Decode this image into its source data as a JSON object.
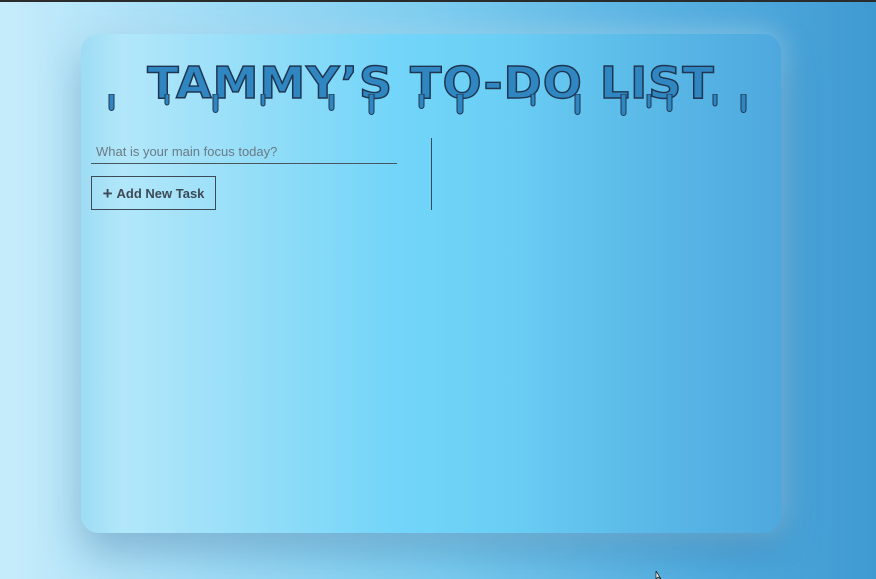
{
  "app": {
    "title": "TAMMY’S TO-DO LIST"
  },
  "task_input": {
    "placeholder": "What is your main focus today?",
    "value": ""
  },
  "add_button": {
    "icon": "plus-icon",
    "icon_glyph": "+",
    "label": "Add New Task"
  },
  "colors": {
    "title_fill": "#2f86c0",
    "title_outline": "#1f3550"
  }
}
